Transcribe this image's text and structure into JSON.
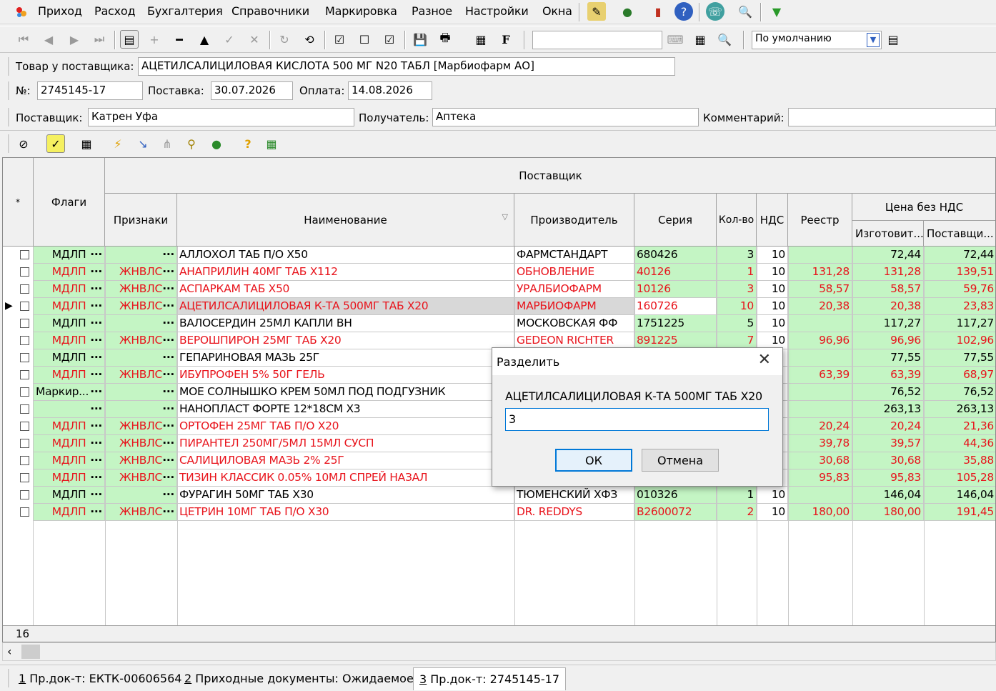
{
  "menu": [
    "Приход",
    "Расход",
    "Бухгалтерия",
    "Справочники",
    "Маркировка",
    "Разное",
    "Настройки",
    "Окна"
  ],
  "toolbar": {
    "profile_value": "По умолчанию",
    "search_value": ""
  },
  "header": {
    "product_label": "Товар у поставщика:",
    "product_value": "АЦЕТИЛСАЛИЦИЛОВАЯ КИСЛОТА 500 МГ N20 ТАБЛ [Марбиофарм АО]",
    "number_label": "№:",
    "number_value": "2745145-17",
    "delivery_label": "Поставка:",
    "delivery_value": "30.07.2026",
    "payment_label": "Оплата:",
    "payment_value": "14.08.2026",
    "supplier_label": "Поставщик:",
    "supplier_value": "Катрен Уфа",
    "recipient_label": "Получатель:",
    "recipient_value": "Аптека",
    "comment_label": "Комментарий:",
    "comment_value": ""
  },
  "grid": {
    "headers": {
      "star": "*",
      "flags": "Флаги",
      "supplier_group": "Поставщик",
      "signs": "Признаки",
      "name": "Наименование",
      "manufacturer": "Производитель",
      "series": "Серия",
      "qty": "Кол-во",
      "vat": "НДС",
      "registry": "Реестр",
      "price_group": "Цена без НДС",
      "price_mfr": "Изготовит...",
      "price_sup": "Поставщи..."
    },
    "rows": [
      {
        "flag": "МДЛП",
        "sign": "",
        "name": "АЛЛОХОЛ ТАБ П/О Х50",
        "mfr": "ФАРМСТАНДАРТ",
        "series": "680426",
        "qty": "3",
        "vat": "10",
        "reg": "",
        "pm": "72,44",
        "ps": "72,44",
        "red": false
      },
      {
        "flag": "МДЛП",
        "sign": "ЖНВЛС",
        "name": "АНАПРИЛИН 40МГ ТАБ Х112",
        "mfr": "ОБНОВЛЕНИЕ",
        "series": "40126",
        "qty": "1",
        "vat": "10",
        "reg": "131,28",
        "pm": "131,28",
        "ps": "139,51",
        "red": true
      },
      {
        "flag": "МДЛП",
        "sign": "ЖНВЛС",
        "name": "АСПАРКАМ ТАБ Х50",
        "mfr": "УРАЛБИОФАРМ",
        "series": "10126",
        "qty": "3",
        "vat": "10",
        "reg": "58,57",
        "pm": "58,57",
        "ps": "59,76",
        "red": true
      },
      {
        "flag": "МДЛП",
        "sign": "ЖНВЛС",
        "name": "АЦЕТИЛСАЛИЦИЛОВАЯ К-ТА 500МГ ТАБ Х20",
        "mfr": "МАРБИОФАРМ",
        "series": "160726",
        "qty": "10",
        "vat": "10",
        "reg": "20,38",
        "pm": "20,38",
        "ps": "23,83",
        "red": true,
        "selected": true
      },
      {
        "flag": "МДЛП",
        "sign": "",
        "name": "ВАЛОСЕРДИН 25МЛ КАПЛИ ВН",
        "mfr": "МОСКОВСКАЯ ФФ",
        "series": "1751225",
        "qty": "5",
        "vat": "10",
        "reg": "",
        "pm": "117,27",
        "ps": "117,27",
        "red": false
      },
      {
        "flag": "МДЛП",
        "sign": "ЖНВЛС",
        "name": "ВЕРОШПИРОН 25МГ ТАБ Х20",
        "mfr": "GEDEON RICHTER",
        "series": "891225",
        "qty": "7",
        "vat": "10",
        "reg": "96,96",
        "pm": "96,96",
        "ps": "102,96",
        "red": true
      },
      {
        "flag": "МДЛП",
        "sign": "",
        "name": "ГЕПАРИНОВАЯ МАЗЬ 25Г",
        "mfr": "",
        "series": "",
        "qty": "",
        "vat": "",
        "reg": "",
        "pm": "77,55",
        "ps": "77,55",
        "red": false
      },
      {
        "flag": "МДЛП",
        "sign": "ЖНВЛС",
        "name": "ИБУПРОФЕН 5% 50Г ГЕЛЬ",
        "mfr": "",
        "series": "",
        "qty": "",
        "vat": "",
        "reg": "63,39",
        "pm": "63,39",
        "ps": "68,97",
        "red": true
      },
      {
        "flag": "Маркир...",
        "sign": "",
        "name": "МОЕ СОЛНЫШКО КРЕМ 50МЛ ПОД ПОДГУЗНИК",
        "mfr": "",
        "series": "",
        "qty": "",
        "vat": "",
        "reg": "",
        "pm": "76,52",
        "ps": "76,52",
        "red": false
      },
      {
        "flag": "",
        "sign": "",
        "name": "НАНОПЛАСТ ФОРТЕ 12*18СМ Х3",
        "mfr": "",
        "series": "",
        "qty": "",
        "vat": "",
        "reg": "",
        "pm": "263,13",
        "ps": "263,13",
        "red": false
      },
      {
        "flag": "МДЛП",
        "sign": "ЖНВЛС",
        "name": "ОРТОФЕН 25МГ ТАБ П/О Х20",
        "mfr": "",
        "series": "",
        "qty": "",
        "vat": "",
        "reg": "20,24",
        "pm": "20,24",
        "ps": "21,36",
        "red": true
      },
      {
        "flag": "МДЛП",
        "sign": "ЖНВЛС",
        "name": "ПИРАНТЕЛ 250МГ/5МЛ 15МЛ СУСП",
        "mfr": "",
        "series": "",
        "qty": "",
        "vat": "",
        "reg": "39,78",
        "pm": "39,57",
        "ps": "44,36",
        "red": true
      },
      {
        "flag": "МДЛП",
        "sign": "ЖНВЛС",
        "name": "САЛИЦИЛОВАЯ МАЗЬ 2% 25Г",
        "mfr": "",
        "series": "",
        "qty": "",
        "vat": "",
        "reg": "30,68",
        "pm": "30,68",
        "ps": "35,88",
        "red": true
      },
      {
        "flag": "МДЛП",
        "sign": "ЖНВЛС",
        "name": "ТИЗИН КЛАССИК 0.05% 10МЛ СПРЕЙ НАЗАЛ",
        "mfr": "",
        "series": "",
        "qty": "",
        "vat": "",
        "reg": "95,83",
        "pm": "95,83",
        "ps": "105,28",
        "red": true
      },
      {
        "flag": "МДЛП",
        "sign": "",
        "name": "ФУРАГИН 50МГ ТАБ Х30",
        "mfr": "ТЮМЕНСКИЙ ХФЗ",
        "series": "010326",
        "qty": "1",
        "vat": "10",
        "reg": "",
        "pm": "146,04",
        "ps": "146,04",
        "red": false
      },
      {
        "flag": "МДЛП",
        "sign": "ЖНВЛС",
        "name": "ЦЕТРИН 10МГ ТАБ П/О Х30",
        "mfr": "DR. REDDYS",
        "series": "B2600072",
        "qty": "2",
        "vat": "10",
        "reg": "180,00",
        "pm": "180,00",
        "ps": "191,45",
        "red": true
      }
    ],
    "ellipsis": "···",
    "footer_count": "16"
  },
  "dialog": {
    "title": "Разделить",
    "message": "АЦЕТИЛСАЛИЦИЛОВАЯ К-ТА 500МГ ТАБ Х20",
    "input_value": "3",
    "ok": "ОК",
    "cancel": "Отмена"
  },
  "tabs": [
    {
      "num": "1",
      "label": " Пр.док-т: ЕКТК-00606564"
    },
    {
      "num": "2",
      "label": " Приходные документы: Ожидаемое"
    },
    {
      "num": "3",
      "label": " Пр.док-т: 2745145-17"
    }
  ]
}
